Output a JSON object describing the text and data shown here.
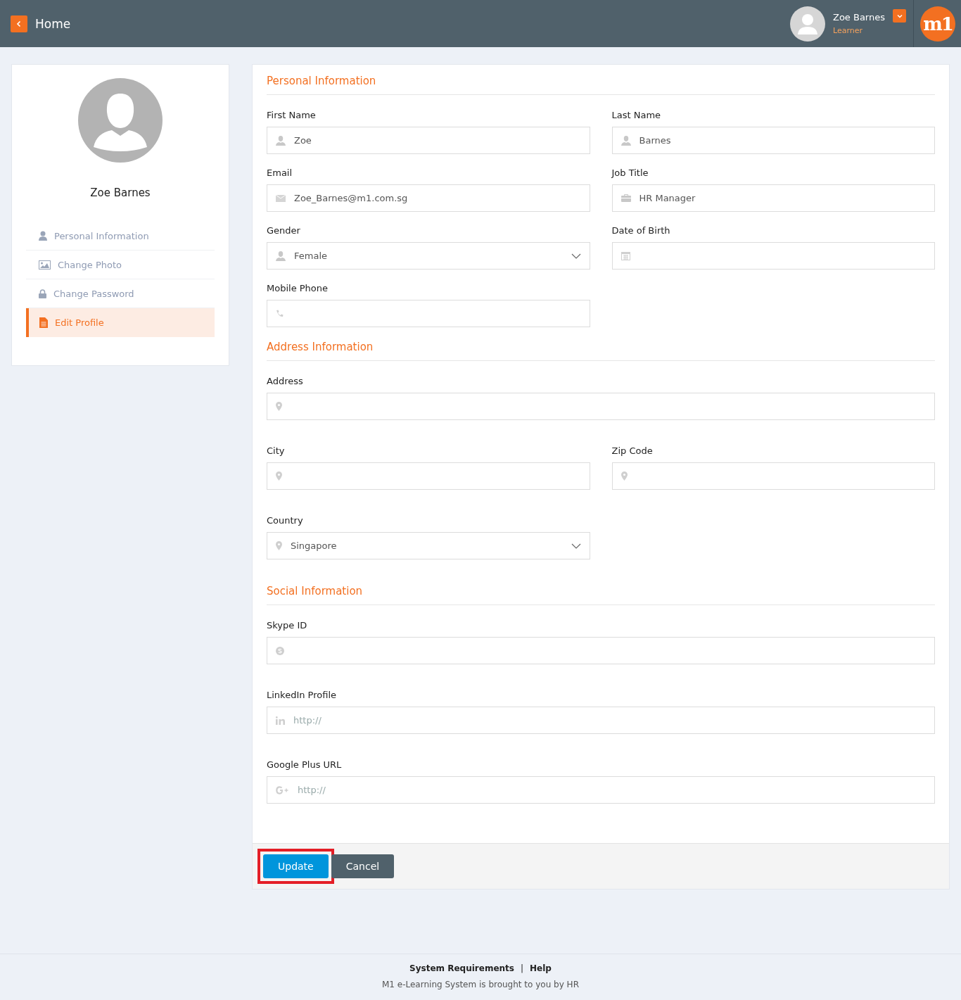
{
  "header": {
    "back_label": "Home",
    "user_name": "Zoe Barnes",
    "user_role": "Learner",
    "logo": "m1"
  },
  "sidebar": {
    "name": "Zoe Barnes",
    "items": [
      {
        "label": "Personal Information",
        "kind": "person",
        "selected": false
      },
      {
        "label": "Change Photo",
        "kind": "photo",
        "selected": false
      },
      {
        "label": "Change Password",
        "kind": "lock",
        "selected": false
      },
      {
        "label": "Edit Profile",
        "kind": "document",
        "selected": true
      }
    ]
  },
  "sections": [
    {
      "title": "Personal Information",
      "fields": [
        {
          "label": "First Name",
          "kind": "name",
          "value": "Zoe"
        },
        {
          "label": "Last Name",
          "kind": "name",
          "value": "Barnes"
        },
        {
          "label": "Email",
          "kind": "email",
          "value": "Zoe_Barnes@m1.com.sg"
        },
        {
          "label": "Job Title",
          "kind": "job",
          "value": "HR Manager"
        },
        {
          "label": "Gender",
          "kind": "gender",
          "value": "Female"
        },
        {
          "label": "Date of Birth",
          "kind": "date"
        },
        {
          "label": "Mobile Phone",
          "kind": "phone"
        }
      ]
    },
    {
      "title": "Address Information",
      "fields": [
        {
          "label": "Address",
          "kind": "address",
          "wide": true
        },
        {
          "label": "City",
          "kind": "location"
        },
        {
          "label": "Zip Code",
          "kind": "location"
        },
        {
          "label": "Country",
          "kind": "country",
          "value": "Singapore"
        }
      ]
    },
    {
      "title": "Social Information",
      "fields": [
        {
          "label": "Skype ID",
          "kind": "skype",
          "wide": true
        },
        {
          "label": "LinkedIn Profile",
          "kind": "linkedin",
          "placeholder": "http://",
          "wide": true
        },
        {
          "label": "Google Plus URL",
          "kind": "googleplus",
          "placeholder": "http://",
          "wide": true
        }
      ]
    }
  ],
  "buttons": [
    {
      "label": "Update",
      "kind": "primary",
      "highlighted": true
    },
    {
      "label": "Cancel",
      "kind": "secondary",
      "highlighted": false
    }
  ],
  "footer": {
    "links": [
      "System Requirements",
      "Help"
    ],
    "separator": "|",
    "note": "M1 e-Learning System is brought to you by HR"
  }
}
